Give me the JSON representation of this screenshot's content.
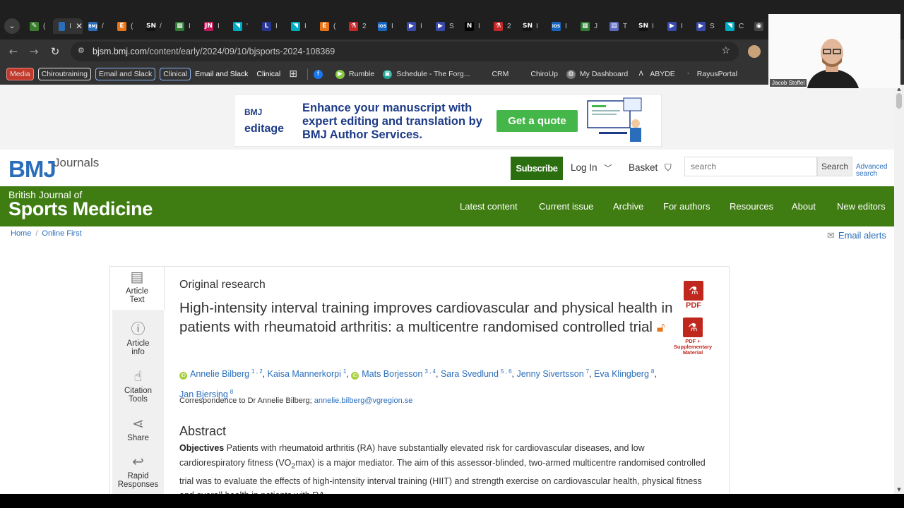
{
  "browser": {
    "tabs": [
      {
        "icon": "leaf-icon",
        "color": "#3a7d2c",
        "glyph": "✎",
        "text": "(",
        "active": false
      },
      {
        "icon": "bmj-tab-icon",
        "color": "#2a6ebb",
        "glyph": "",
        "text": "I",
        "active": true
      },
      {
        "icon": "bmj-icon",
        "color": "#2a6ebb",
        "glyph": "BMJ",
        "text": "/",
        "active": false
      },
      {
        "icon": "e-icon",
        "color": "#e8751a",
        "glyph": "E",
        "text": "(",
        "active": false
      },
      {
        "icon": "sn-icon",
        "color": "#111111",
        "glyph": "SN",
        "text": "/",
        "active": false
      },
      {
        "icon": "grid-icon",
        "color": "#2e7d32",
        "glyph": "▦",
        "text": "I",
        "active": false
      },
      {
        "icon": "jn-icon",
        "color": "#c2185b",
        "glyph": "JN",
        "text": "I",
        "active": false
      },
      {
        "icon": "play-icon",
        "color": "#00acc1",
        "glyph": "◥",
        "text": "'",
        "active": false
      },
      {
        "icon": "l-icon",
        "color": "#283593",
        "glyph": "L",
        "text": "I",
        "active": false
      },
      {
        "icon": "play-icon",
        "color": "#00acc1",
        "glyph": "◥",
        "text": "I",
        "active": false
      },
      {
        "icon": "e-icon",
        "color": "#e8751a",
        "glyph": "E",
        "text": "(",
        "active": false
      },
      {
        "icon": "pdf-icon",
        "color": "#c62828",
        "glyph": "⚗",
        "text": "2",
        "active": false
      },
      {
        "icon": "ios-icon",
        "color": "#1565c0",
        "glyph": "iOS",
        "text": "I",
        "active": false
      },
      {
        "icon": "arrow-icon",
        "color": "#3949ab",
        "glyph": "▶",
        "text": "I",
        "active": false
      },
      {
        "icon": "arrow-icon",
        "color": "#3949ab",
        "glyph": "▶",
        "text": "S",
        "active": false
      },
      {
        "icon": "notion-icon",
        "color": "#000000",
        "glyph": "N",
        "text": "I",
        "active": false
      },
      {
        "icon": "pdf-icon",
        "color": "#c62828",
        "glyph": "⚗",
        "text": "2",
        "active": false
      },
      {
        "icon": "sn-icon",
        "color": "#111111",
        "glyph": "SN",
        "text": "I",
        "active": false
      },
      {
        "icon": "ios-icon",
        "color": "#1565c0",
        "glyph": "iOS",
        "text": "I",
        "active": false
      },
      {
        "icon": "grid-icon",
        "color": "#2e7d32",
        "glyph": "▦",
        "text": "J",
        "active": false
      },
      {
        "icon": "doc-icon",
        "color": "#5c6bc0",
        "glyph": "▤",
        "text": "T",
        "active": false
      },
      {
        "icon": "sn-icon",
        "color": "#111111",
        "glyph": "SN",
        "text": "I",
        "active": false
      },
      {
        "icon": "arrow-icon",
        "color": "#3949ab",
        "glyph": "▶",
        "text": "I",
        "active": false
      },
      {
        "icon": "arrow-icon",
        "color": "#3949ab",
        "glyph": "▶",
        "text": "S",
        "active": false
      },
      {
        "icon": "play-icon",
        "color": "#00acc1",
        "glyph": "◥",
        "text": "C",
        "active": false
      },
      {
        "icon": "chat-icon",
        "color": "#444444",
        "glyph": "◉",
        "text": "",
        "active": false
      }
    ],
    "url_host": "bjsm.bmj.com",
    "url_path": "/content/early/2024/09/10/bjsports-2024-108369",
    "bookmarks": [
      {
        "label": "Media",
        "style": "pill pill-red"
      },
      {
        "label": "Chiroutraining",
        "style": "pill"
      },
      {
        "label": "Email and Slack",
        "style": "pill pill-blue"
      },
      {
        "label": "Clinical",
        "style": "pill pill-blue"
      },
      {
        "label": "Email and Slack",
        "style": "plain-bold"
      },
      {
        "label": "Clinical",
        "style": "plain-bold"
      }
    ],
    "bookmarks2": [
      {
        "label": "",
        "icon": "facebook-icon",
        "color": "#1877f2",
        "glyph": "f"
      },
      {
        "label": "Rumble",
        "icon": "rumble-icon",
        "color": "#85c742",
        "glyph": "▶"
      },
      {
        "label": "Schedule - The Forg...",
        "icon": "schedule-icon",
        "color": "#26a69a",
        "glyph": "▣"
      },
      {
        "label": "CRM",
        "icon": "crm-icon",
        "color": "#333333",
        "glyph": ""
      },
      {
        "label": "ChiroUp",
        "icon": "chiroup-icon",
        "color": "#333333",
        "glyph": ""
      },
      {
        "label": "My Dashboard",
        "icon": "globe-icon",
        "color": "#777777",
        "glyph": "◍"
      },
      {
        "label": "ABYDE",
        "icon": "abyde-icon",
        "color": "#333333",
        "glyph": "Λ"
      },
      {
        "label": "RayusPortal",
        "icon": "rayus-icon",
        "color": "#333333",
        "glyph": "·"
      }
    ]
  },
  "ad": {
    "logo1": "BMJ",
    "logo2": "editage",
    "text": "Enhance your manuscript with expert editing and translation by BMJ Author Services.",
    "button": "Get a quote"
  },
  "header": {
    "logo": "BMJ",
    "journals": "Journals",
    "subscribe": "Subscribe",
    "login": "Log In",
    "basket": "Basket",
    "search_placeholder": "search",
    "search_button": "Search",
    "advanced1": "Advanced",
    "advanced2": "search"
  },
  "journal": {
    "line1": "British Journal of",
    "line2": "Sports Medicine",
    "nav": [
      "Latest content",
      "Current issue",
      "Archive",
      "For authors",
      "Resources",
      "About",
      "New editors"
    ]
  },
  "breadcrumb": [
    "Home",
    "Online First"
  ],
  "email_alerts": "Email alerts",
  "tools": [
    {
      "label1": "Article",
      "label2": "Text",
      "icon": "document-icon",
      "glyph": "▤"
    },
    {
      "label1": "Article",
      "label2": "info",
      "icon": "info-icon",
      "glyph": "ⓘ"
    },
    {
      "label1": "Citation",
      "label2": "Tools",
      "icon": "thumbs-up-icon",
      "glyph": "👍"
    },
    {
      "label1": "Share",
      "label2": "",
      "icon": "share-icon",
      "glyph": "⊲"
    },
    {
      "label1": "Rapid",
      "label2": "Responses",
      "icon": "reply-icon",
      "glyph": "↩"
    }
  ],
  "article": {
    "type": "Original research",
    "title": "High-intensity interval training improves cardiovascular and physical health in patients with rheumatoid arthritis: a multicentre randomised controlled trial",
    "open_access": "🔓",
    "authors": [
      {
        "name": "Annelie Bilberg",
        "sup": "1 , 2",
        "orcid": true
      },
      {
        "name": "Kaisa Mannerkorpi",
        "sup": "1",
        "orcid": false
      },
      {
        "name": "Mats Borjesson",
        "sup": "3 , 4",
        "orcid": true
      },
      {
        "name": "Sara Svedlund",
        "sup": "5 , 6",
        "orcid": false
      },
      {
        "name": "Jenny Sivertsson",
        "sup": "7",
        "orcid": false
      },
      {
        "name": "Eva Klingberg",
        "sup": "8",
        "orcid": false
      },
      {
        "name": "Jan Bjersing",
        "sup": "8",
        "orcid": false
      }
    ],
    "correspondence_prefix": "Correspondence to Dr Annelie Bilberg;",
    "correspondence_email": "annelie.bilberg@vgregion.se",
    "pdf": "PDF",
    "pdf2_line1": "PDF +",
    "pdf2_line2": "Supplementary",
    "pdf2_line3": "Material",
    "abstract_heading": "Abstract",
    "objectives_label": "Objectives",
    "abstract_a": " Patients with rheumatoid arthritis (RA) have substantially elevated risk for cardiovascular diseases, and low cardiorespiratory fitness (VO",
    "abstract_sub": "2",
    "abstract_b": "max) is a major mediator. The aim of this assessor-blinded, two-armed multicentre randomised controlled trial was to evaluate the effects of high-intensity interval training (HIIT) and strength exercise on cardiovascular health, physical fitness and overall health in patients with RA."
  },
  "webcam": {
    "name": "Jacob Stoffel"
  }
}
